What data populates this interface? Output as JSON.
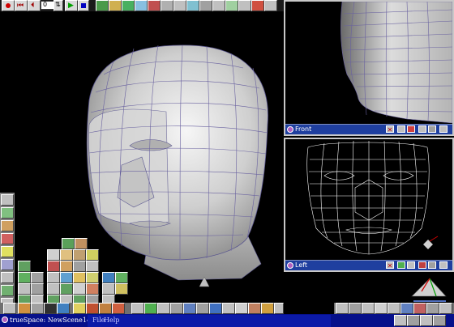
{
  "app": {
    "status_label": "trueSpace: NewScene14",
    "menu": [
      "File",
      "Help"
    ],
    "frame_value": "0"
  },
  "viewports": {
    "front": {
      "title": "Front",
      "close_glyph": "✕"
    },
    "left": {
      "title": "Left",
      "close_glyph": "✕"
    }
  },
  "colors": {
    "title_bar": "#1f3f9f",
    "status_bar": "#06108a",
    "mesh_surface": "#d8d8d8",
    "wire_lines": "#6a62a0",
    "background": "#000000"
  },
  "icons": [
    "record-icon",
    "rewind-icon",
    "play-icon",
    "stop-icon",
    "frame-forward-icon",
    "sphere-icon",
    "cube-icon",
    "cone-icon",
    "light-icon",
    "camera-icon",
    "grid-icon"
  ]
}
